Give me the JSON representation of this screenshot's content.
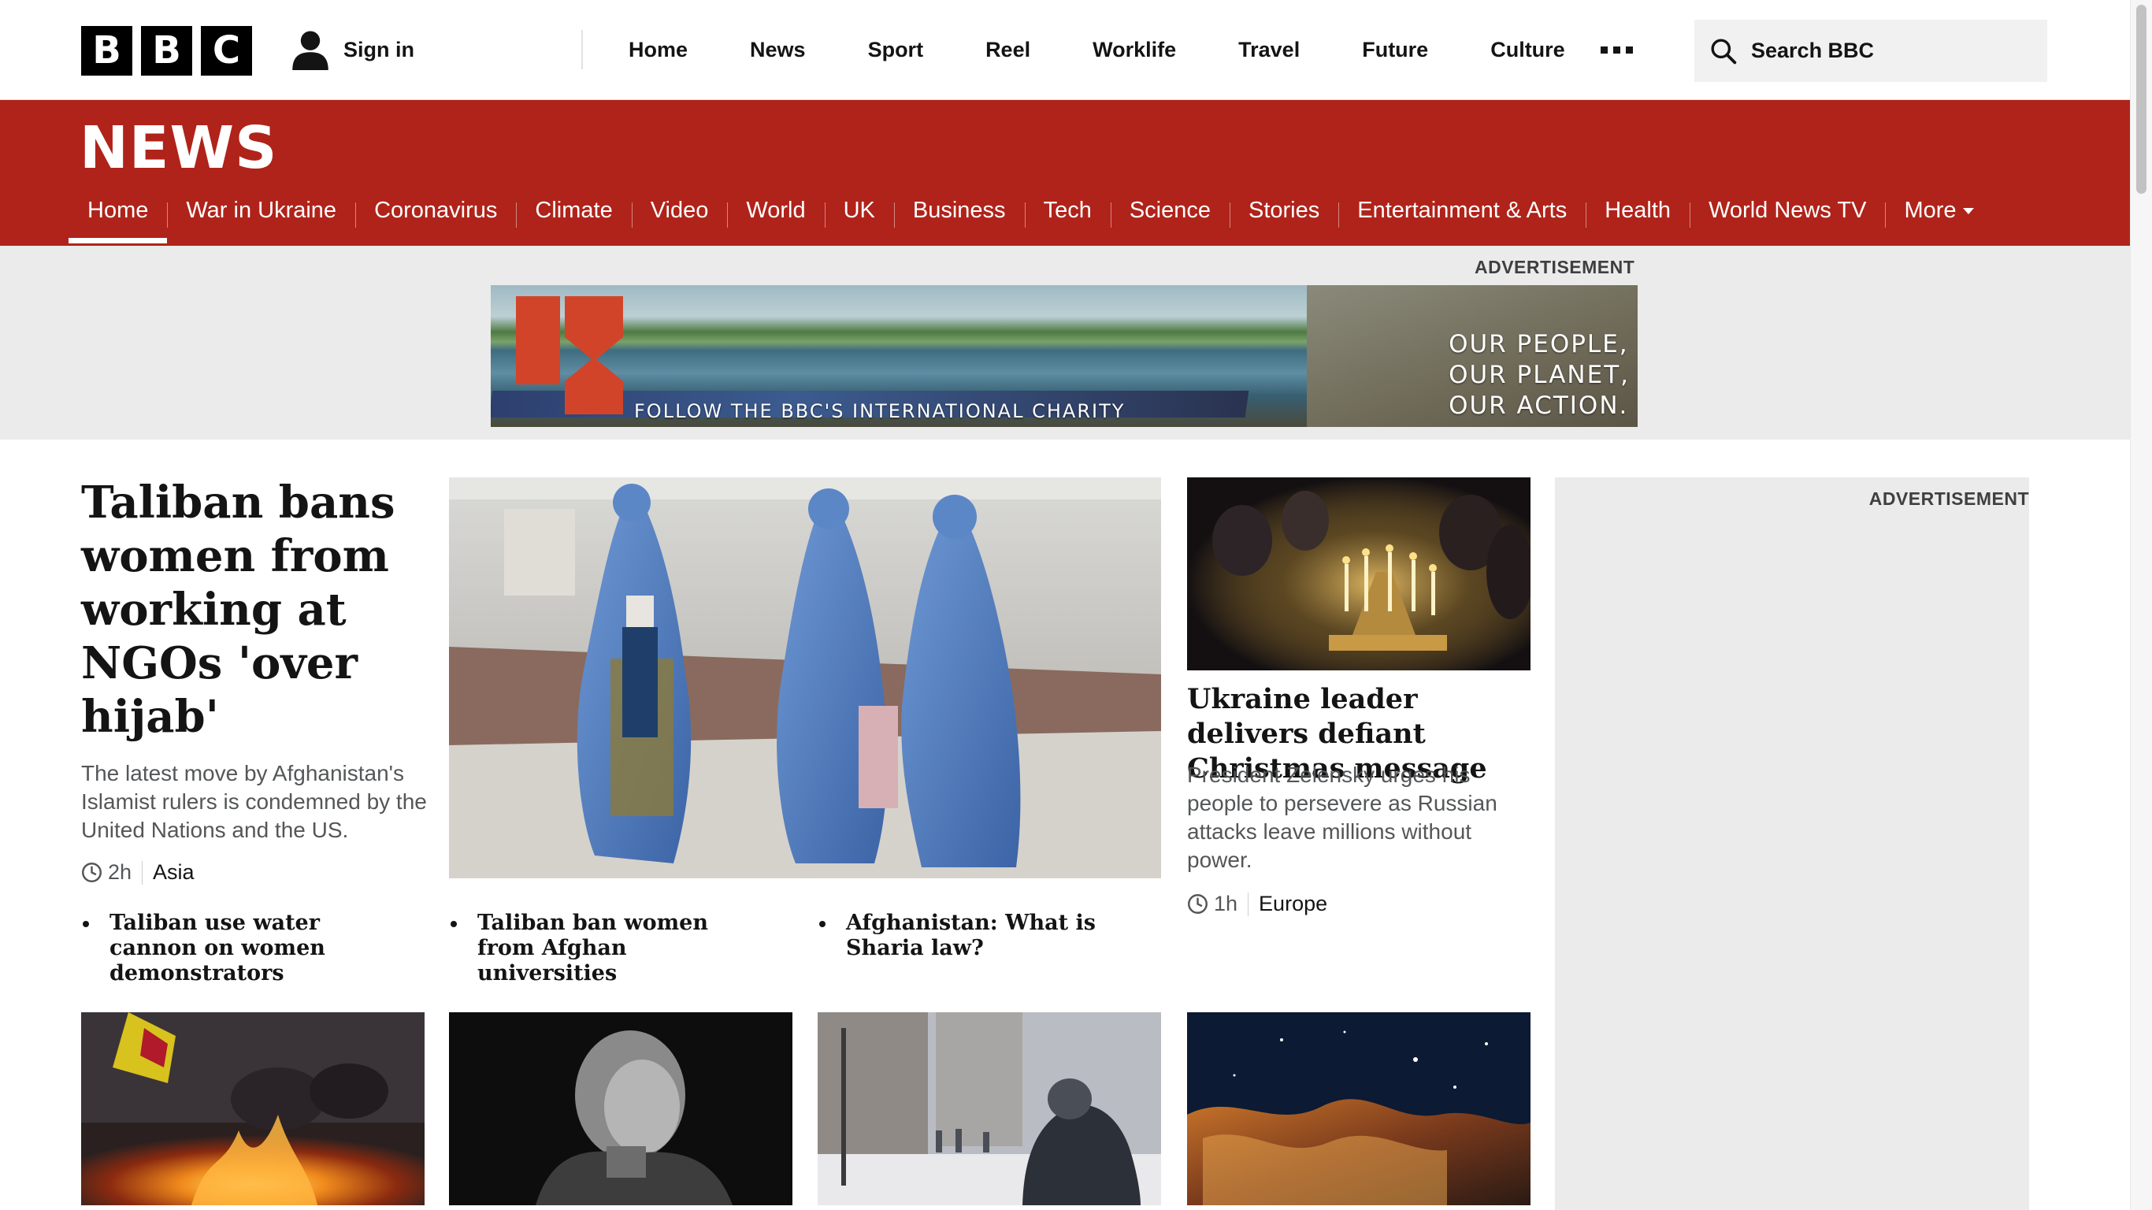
{
  "header": {
    "logo_letters": [
      "B",
      "B",
      "C"
    ],
    "sign_in_label": "Sign in",
    "nav": [
      "Home",
      "News",
      "Sport",
      "Reel",
      "Worklife",
      "Travel",
      "Future",
      "Culture"
    ],
    "search_placeholder": "Search BBC"
  },
  "news_header": {
    "title": "NEWS",
    "nav": [
      {
        "label": "Home",
        "active": true
      },
      {
        "label": "War in Ukraine"
      },
      {
        "label": "Coronavirus"
      },
      {
        "label": "Climate"
      },
      {
        "label": "Video"
      },
      {
        "label": "World"
      },
      {
        "label": "UK"
      },
      {
        "label": "Business"
      },
      {
        "label": "Tech"
      },
      {
        "label": "Science"
      },
      {
        "label": "Stories"
      },
      {
        "label": "Entertainment & Arts"
      },
      {
        "label": "Health"
      },
      {
        "label": "World News TV"
      },
      {
        "label": "More"
      }
    ]
  },
  "top_advert": {
    "label": "ADVERTISEMENT",
    "banner_follow": "FOLLOW THE BBC'S INTERNATIONAL CHARITY",
    "banner_slogan": [
      "OUR PEOPLE,",
      "OUR PLANET,",
      "OUR ACTION."
    ]
  },
  "lead_story": {
    "title": "Taliban bans women from working at NGOs 'over hijab'",
    "summary": "The latest move by Afghanistan's Islamist rulers is condemned by the United Nations and the US.",
    "time": "2h",
    "category": "Asia",
    "image": "women-in-blue-burqas-photo",
    "related": [
      "Taliban use water cannon on women demonstrators",
      "Taliban ban women from Afghan universities",
      "Afghanistan: What is Sharia law?"
    ]
  },
  "secondary_story": {
    "title": "Ukraine leader delivers defiant Christmas message",
    "summary": "President Zelensky urges his people to persevere as Russian attacks leave millions without power.",
    "time": "1h",
    "category": "Europe",
    "image": "candles-in-church-photo"
  },
  "side_advert": {
    "label": "ADVERTISEMENT"
  },
  "bottom_row": [
    {
      "image": "protest-fire-photo"
    },
    {
      "image": "musician-portrait-photo"
    },
    {
      "image": "snowy-street-photo"
    },
    {
      "image": "space-nebula-photo"
    }
  ],
  "colors": {
    "news_red": "#b0231a",
    "text_dark": "#141414",
    "text_grey": "#545658",
    "advert_bg": "#ebebeb"
  }
}
